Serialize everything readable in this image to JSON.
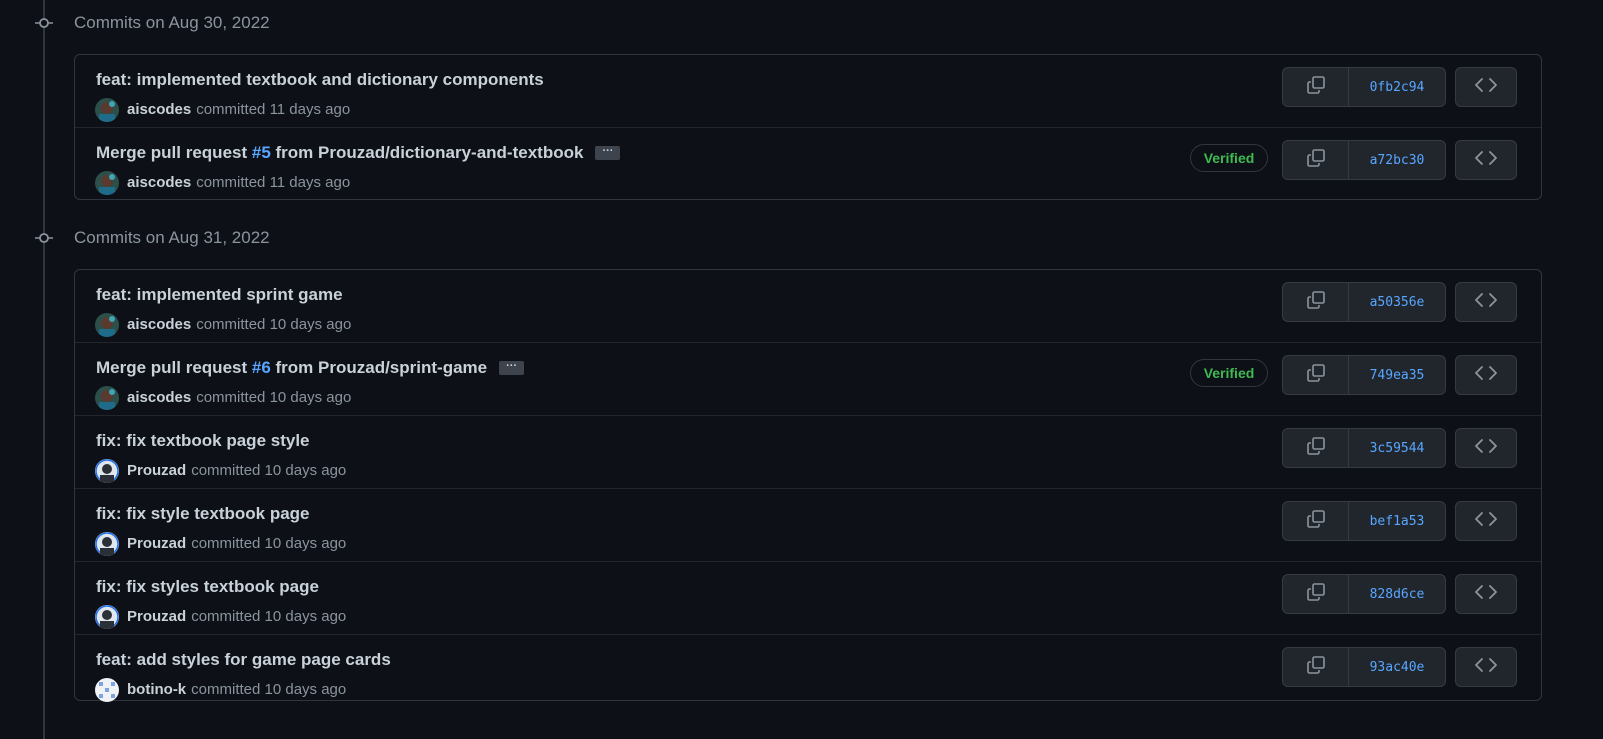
{
  "groups": [
    {
      "title": "Commits on Aug 30, 2022",
      "commits": [
        {
          "message": "feat: implemented textbook and dictionary components",
          "author": "aiscodes",
          "when": "committed 11 days ago",
          "sha": "0fb2c94",
          "avatar": "aiscodes-avatar"
        },
        {
          "message_prefix": "Merge pull request ",
          "pr": "#5",
          "message_suffix": " from Prouzad/dictionary-and-textbook",
          "ellipsis": "···",
          "verified": "Verified",
          "author": "aiscodes",
          "when": "committed 11 days ago",
          "sha": "a72bc30",
          "avatar": "aiscodes-avatar"
        }
      ]
    },
    {
      "title": "Commits on Aug 31, 2022",
      "commits": [
        {
          "message": "feat: implemented sprint game",
          "author": "aiscodes",
          "when": "committed 10 days ago",
          "sha": "a50356e",
          "avatar": "aiscodes-avatar"
        },
        {
          "message_prefix": "Merge pull request ",
          "pr": "#6",
          "message_suffix": " from Prouzad/sprint-game",
          "ellipsis": "···",
          "verified": "Verified",
          "author": "aiscodes",
          "when": "committed 10 days ago",
          "sha": "749ea35",
          "avatar": "aiscodes-avatar"
        },
        {
          "message": "fix: fix textbook page style",
          "author": "Prouzad",
          "when": "committed 10 days ago",
          "sha": "3c59544",
          "avatar": "prouzad-avatar"
        },
        {
          "message": "fix: fix style textbook page",
          "author": "Prouzad",
          "when": "committed 10 days ago",
          "sha": "bef1a53",
          "avatar": "prouzad-avatar"
        },
        {
          "message": "fix: fix styles textbook page",
          "author": "Prouzad",
          "when": "committed 10 days ago",
          "sha": "828d6ce",
          "avatar": "prouzad-avatar"
        },
        {
          "message": "feat: add styles for game page cards",
          "author": "botino-k",
          "when": "committed 10 days ago",
          "sha": "93ac40e",
          "avatar": "botino-k-avatar"
        }
      ]
    }
  ],
  "icons": {
    "node": "git-commit-icon",
    "copy": "copy-icon",
    "browse": "code-icon"
  },
  "colors": {
    "background": "#0d1117",
    "link": "#58a6ff",
    "verified": "#3fb950",
    "muted": "#8b949e"
  }
}
